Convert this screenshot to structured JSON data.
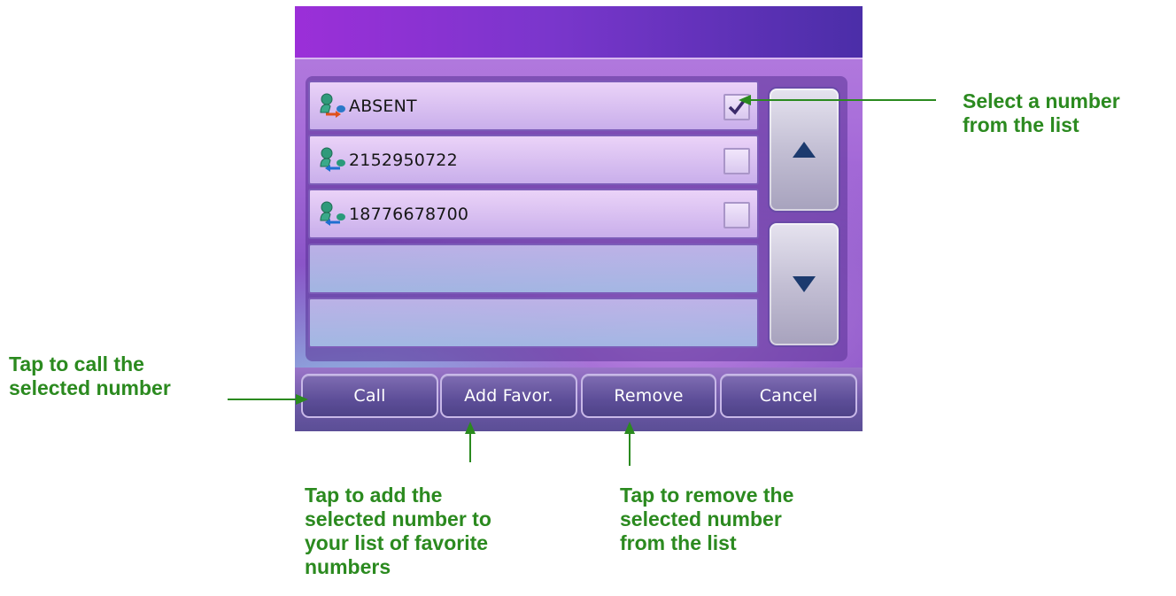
{
  "entries": [
    {
      "label": "ABSENT",
      "checked": true,
      "icon": "contact-outgoing-icon"
    },
    {
      "label": "2152950722",
      "checked": false,
      "icon": "contact-incoming-icon"
    },
    {
      "label": "18776678700",
      "checked": false,
      "icon": "contact-incoming-icon"
    }
  ],
  "buttons": {
    "call": "Call",
    "add_favor": "Add Favor.",
    "remove": "Remove",
    "cancel": "Cancel"
  },
  "scroll": {
    "up_icon": "arrow-up-icon",
    "down_icon": "arrow-down-icon"
  },
  "annotations": {
    "select": [
      "Select a number",
      "from the list"
    ],
    "call": [
      "Tap to call the",
      "selected number"
    ],
    "add": [
      "Tap to add the",
      "selected number to",
      "your list of favorite",
      "numbers"
    ],
    "remove": [
      "Tap to remove the",
      "selected number",
      "from the list"
    ]
  },
  "colors": {
    "annotation": "#2b8a1f",
    "titlebar": "#8a34d2",
    "button": "#5d4e98"
  }
}
